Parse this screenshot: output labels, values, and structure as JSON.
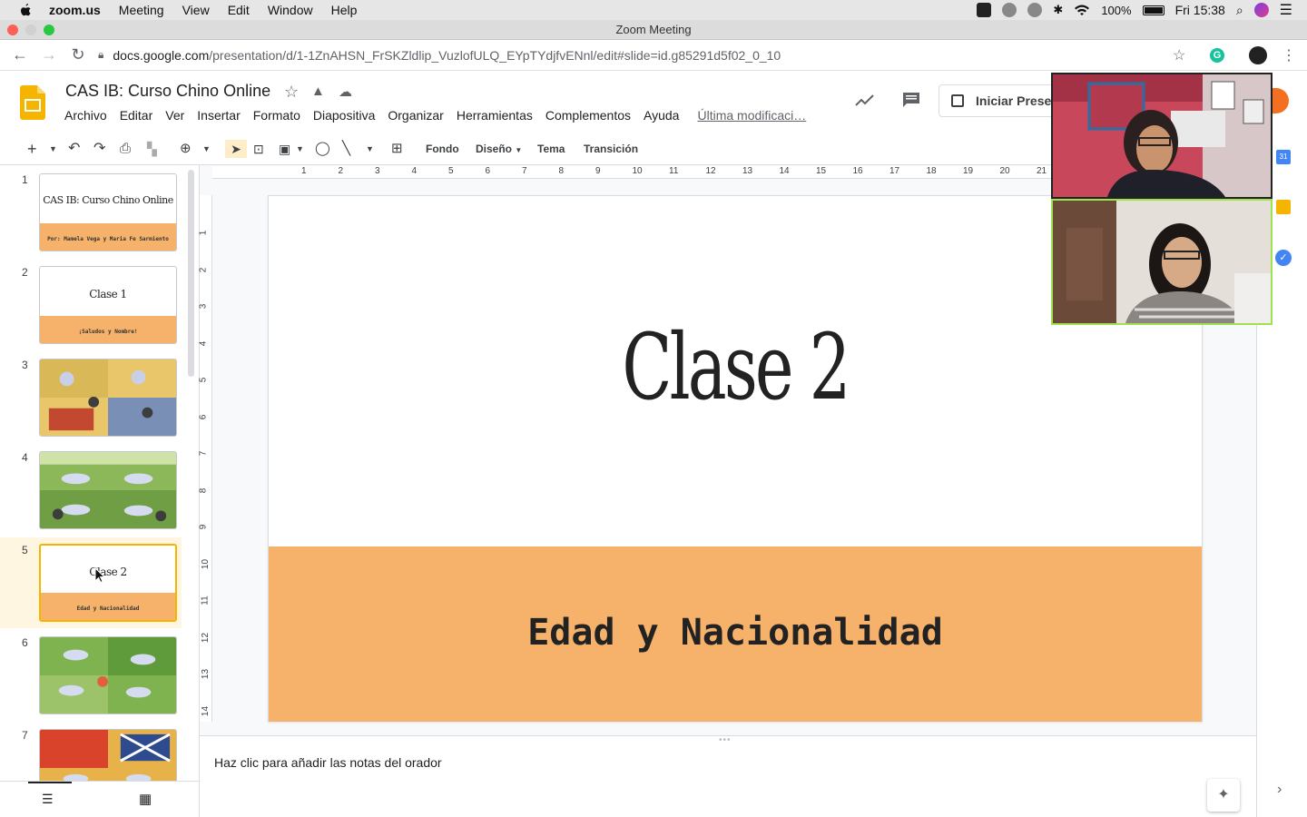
{
  "mac_menubar": {
    "app": "zoom.us",
    "items": [
      "Meeting",
      "View",
      "Edit",
      "Window",
      "Help"
    ],
    "battery": "100%",
    "clock": "Fri 15:38"
  },
  "window": {
    "title": "Zoom Meeting"
  },
  "browser": {
    "url_host": "docs.google.com",
    "url_path": "/presentation/d/1-1ZnAHSN_FrSKZldlip_VuzlofULQ_EYpTYdjfvENnl/edit#slide=id.g85291d5f02_0_10"
  },
  "doc": {
    "title": "CAS IB: Curso Chino Online",
    "menus": [
      "Archivo",
      "Editar",
      "Ver",
      "Insertar",
      "Formato",
      "Diapositiva",
      "Organizar",
      "Herramientas",
      "Complementos",
      "Ayuda"
    ],
    "last_edit": "Última modificaci…",
    "present_button": "Iniciar Prese"
  },
  "toolbar": {
    "fondo": "Fondo",
    "diseno": "Diseño",
    "tema": "Tema",
    "transicion": "Transición"
  },
  "ruler": {
    "top": [
      "1",
      "2",
      "3",
      "4",
      "5",
      "6",
      "7",
      "8",
      "9",
      "10",
      "11",
      "12",
      "13",
      "14",
      "15",
      "16",
      "17",
      "18",
      "19",
      "20",
      "21"
    ],
    "left": [
      "1",
      "2",
      "3",
      "4",
      "5",
      "6",
      "7",
      "8",
      "9",
      "10",
      "11",
      "12",
      "13",
      "14"
    ]
  },
  "slides": [
    {
      "num": "1",
      "title": "CAS IB: Curso Chino Online",
      "subtitle": "Por: Mamela Vega y Maria Fe Sarmiento"
    },
    {
      "num": "2",
      "title": "Clase 1",
      "subtitle": "¡Saludos y Nombre!"
    },
    {
      "num": "3"
    },
    {
      "num": "4"
    },
    {
      "num": "5",
      "title": "Clase 2",
      "subtitle": "Edad y Nacionalidad"
    },
    {
      "num": "6"
    },
    {
      "num": "7"
    }
  ],
  "current_slide": {
    "title": "Clase 2",
    "subtitle": "Edad y Nacionalidad"
  },
  "notes": {
    "placeholder": "Haz clic para añadir las notas del orador"
  },
  "colors": {
    "accent_band": "#f6b26b",
    "selection": "#fef6e0"
  }
}
